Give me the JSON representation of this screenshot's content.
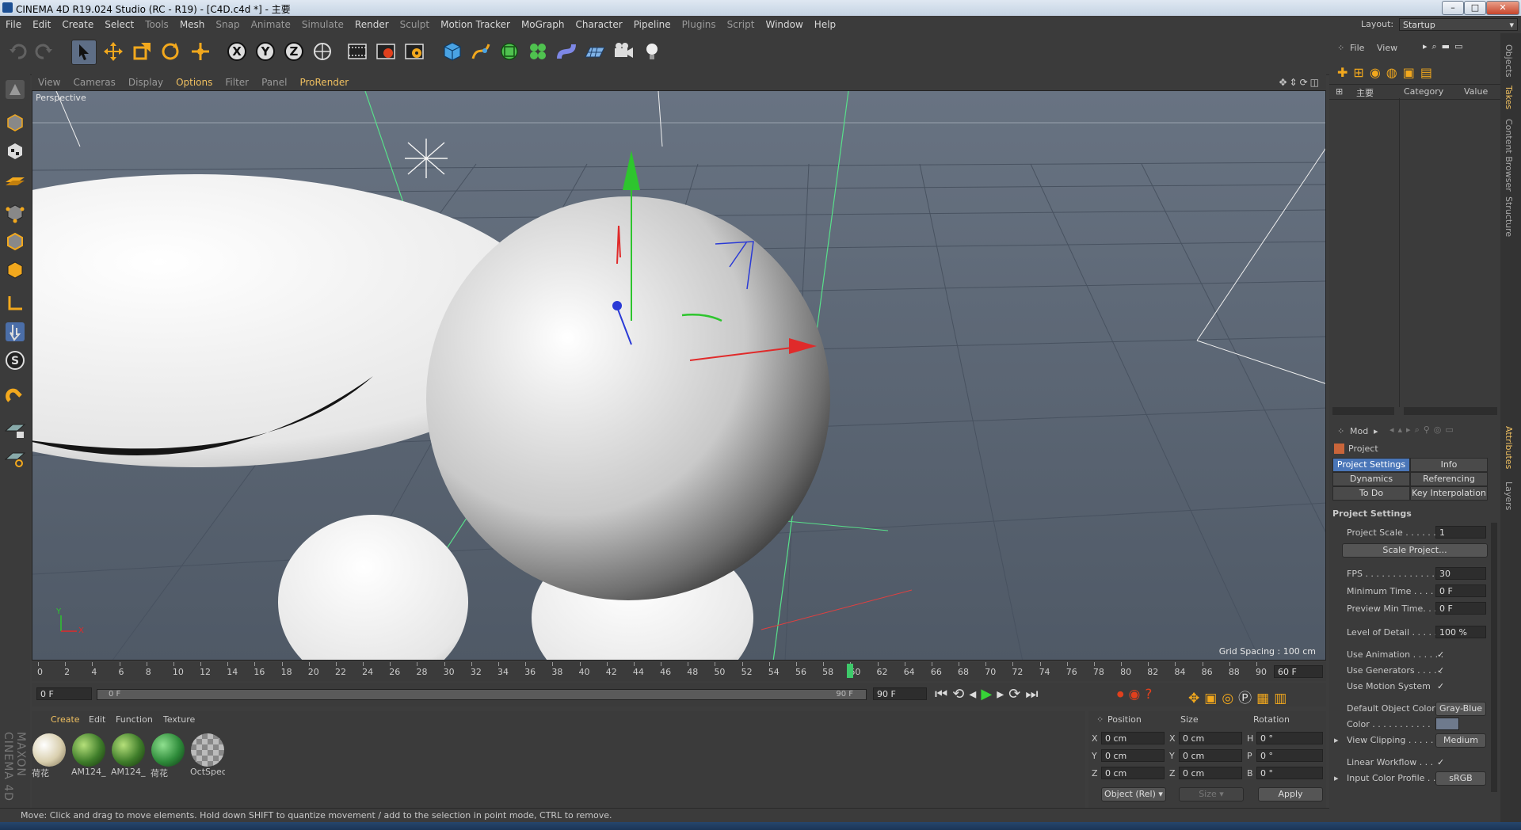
{
  "title_bar": {
    "title": "CINEMA 4D R19.024 Studio (RC - R19) - [C4D.c4d *] - 主要",
    "min": "–",
    "max": "□",
    "close": "✕"
  },
  "menu": [
    "File",
    "Edit",
    "Create",
    "Select",
    "Tools",
    "Mesh",
    "Snap",
    "Animate",
    "Simulate",
    "Render",
    "Sculpt",
    "Motion Tracker",
    "MoGraph",
    "Character",
    "Pipeline",
    "Plugins",
    "Script",
    "Window",
    "Help"
  ],
  "layout": {
    "label": "Layout:",
    "value": "Startup"
  },
  "viewport": {
    "menu": [
      "View",
      "Cameras",
      "Display",
      "Options",
      "Filter",
      "Panel",
      "ProRender"
    ],
    "label": "Perspective",
    "grid_spacing": "Grid Spacing : 100 cm",
    "axis_y": "Y",
    "axis_x": "X"
  },
  "timeline": {
    "ticks": [
      "0",
      "2",
      "4",
      "6",
      "8",
      "10",
      "12",
      "14",
      "16",
      "18",
      "20",
      "22",
      "24",
      "26",
      "28",
      "30",
      "32",
      "34",
      "36",
      "38",
      "40",
      "42",
      "44",
      "46",
      "48",
      "50",
      "52",
      "54",
      "56",
      "58",
      "60",
      "62",
      "64",
      "66",
      "68",
      "70",
      "72",
      "74",
      "76",
      "78",
      "80",
      "82",
      "84",
      "86",
      "88",
      "90"
    ],
    "current_frame": 60,
    "end_label": "60 F",
    "start_field": "0 F",
    "range_start": "0 F",
    "range_end": "90 F",
    "end_field": "90 F"
  },
  "material_manager": {
    "menu": [
      "Create",
      "Edit",
      "Function",
      "Texture"
    ],
    "materials": [
      {
        "name": "荷花",
        "color": "#d9cfae"
      },
      {
        "name": "AM124_",
        "color": "#3f7d2a"
      },
      {
        "name": "AM124_",
        "color": "#3f7d2a"
      },
      {
        "name": "荷花",
        "color": "#2e8b3a"
      },
      {
        "name": "OctSpec",
        "color": "#9a9a9a"
      }
    ]
  },
  "coordinates": {
    "headers": [
      "Position",
      "Size",
      "Rotation"
    ],
    "rows": [
      {
        "pos_label": "X",
        "pos": "0 cm",
        "size_label": "X",
        "size": "0 cm",
        "rot_label": "H",
        "rot": "0 °"
      },
      {
        "pos_label": "Y",
        "pos": "0 cm",
        "size_label": "Y",
        "size": "0 cm",
        "rot_label": "P",
        "rot": "0 °"
      },
      {
        "pos_label": "Z",
        "pos": "0 cm",
        "size_label": "Z",
        "size": "0 cm",
        "rot_label": "B",
        "rot": "0 °"
      }
    ],
    "mode": "Object (Rel)",
    "size_mode": "Size",
    "apply": "Apply"
  },
  "status": "Move: Click and drag to move elements. Hold down SHIFT to quantize movement / add to the selection in point mode, CTRL to remove.",
  "objects_panel": {
    "menu": [
      "File",
      "View"
    ],
    "take_name": "主要",
    "col_category": "Category",
    "col_value": "Value"
  },
  "attributes": {
    "mode": "Mod",
    "object": "Project",
    "tabs": [
      "Project Settings",
      "Info",
      "Dynamics",
      "Referencing",
      "To Do",
      "Key Interpolation"
    ],
    "section": "Project Settings",
    "fields": [
      {
        "label": "Project Scale . . . . . . .",
        "value": "1"
      },
      {
        "label": "FPS . . . . . . . . . . . . . . .",
        "value": "30"
      },
      {
        "label": "Minimum Time . . . . .",
        "value": "0 F"
      },
      {
        "label": "Preview Min Time. . .",
        "value": "0 F"
      },
      {
        "label": "Level of Detail . . . . .",
        "value": "100 %"
      }
    ],
    "scale_project": "Scale Project...",
    "checks": [
      {
        "label": "Use Animation . . . . . .",
        "value": "✓"
      },
      {
        "label": "Use Generators . . . . .",
        "value": "✓"
      },
      {
        "label": "Use Motion System",
        "value": "✓"
      }
    ],
    "default_color_label": "Default Object Color",
    "default_color_value": "Gray-Blue",
    "color_label": "Color . . . . . . . . . . .",
    "view_clipping_label": "View Clipping . . . . .",
    "view_clipping_value": "Medium",
    "linear_workflow_label": "Linear Workflow . . .",
    "linear_workflow_value": "✓",
    "input_profile_label": "Input Color Profile . .",
    "input_profile_value": "sRGB"
  },
  "right_tabs": [
    "Objects",
    "Takes",
    "Content Browser",
    "Structure",
    "Attributes",
    "Layers"
  ],
  "logo": "MAXON CINEMA 4D"
}
